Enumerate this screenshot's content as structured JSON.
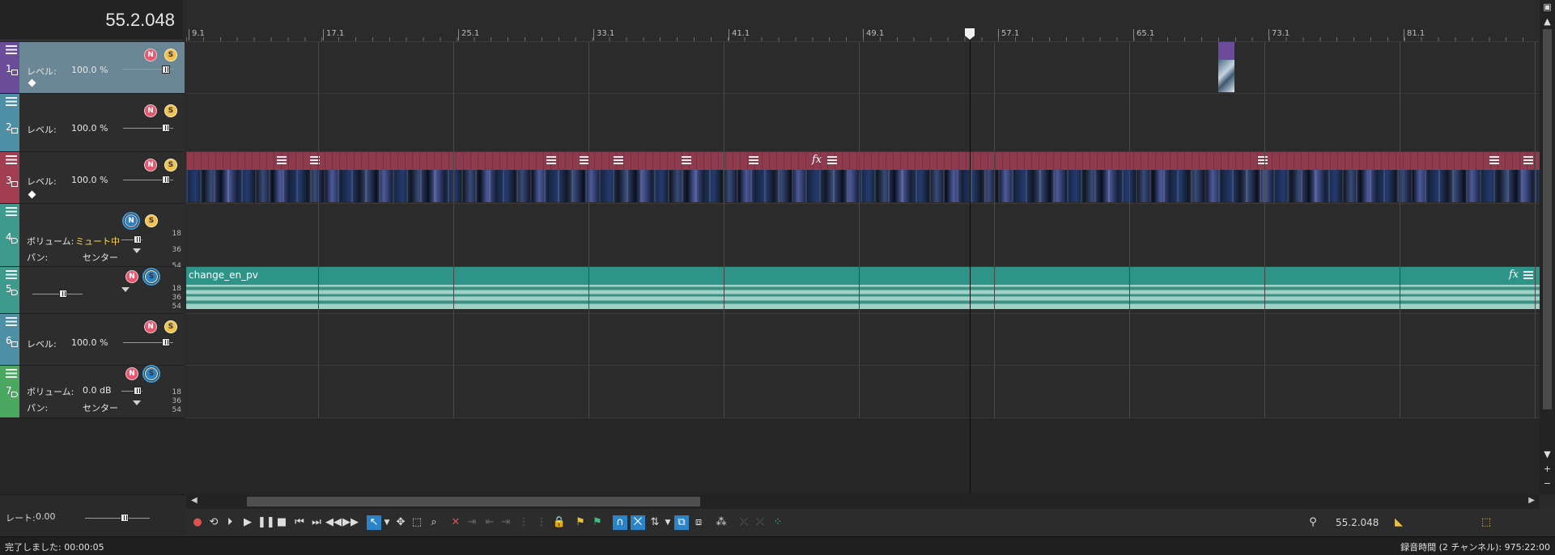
{
  "time_display": "55.2.048",
  "ruler": {
    "labels": [
      "9.1",
      "17.1",
      "25.1",
      "33.1",
      "41.1",
      "49.1",
      "57.1",
      "65.1",
      "73.1",
      "81.1"
    ]
  },
  "tracks": [
    {
      "number": "1",
      "color": "#6b4c9a",
      "type": "video",
      "param_label": "レベル:",
      "param_value": "100.0 %"
    },
    {
      "number": "2",
      "color": "#4d8fa5",
      "type": "video",
      "param_label": "レベル:",
      "param_value": "100.0 %"
    },
    {
      "number": "3",
      "color": "#a33d52",
      "type": "video",
      "param_label": "レベル:",
      "param_value": "100.0 %"
    },
    {
      "number": "4",
      "color": "#3f9a8e",
      "type": "audio",
      "param_label": "ボリューム:",
      "param_value": "ミュート中",
      "pan_label": "パン:",
      "pan_value": "センター",
      "db_scale": [
        "18",
        "36",
        "54"
      ]
    },
    {
      "number": "5",
      "color": "#3f9a8e",
      "type": "audio",
      "db_scale": [
        "18",
        "36",
        "54"
      ]
    },
    {
      "number": "6",
      "color": "#4d8fa5",
      "type": "video",
      "param_label": "レベル:",
      "param_value": "100.0 %"
    },
    {
      "number": "7",
      "color": "#4aa860",
      "type": "audio",
      "param_label": "ボリューム:",
      "param_value": "0.0 dB",
      "pan_label": "パン:",
      "pan_value": "センター",
      "db_scale": [
        "18",
        "36",
        "54"
      ]
    }
  ],
  "audio_event": {
    "name": "change_en_pv"
  },
  "rate": {
    "label": "レート:",
    "value": "0.00"
  },
  "transport": {
    "time": "55.2.048"
  },
  "status": {
    "left": "完了しました: 00:00:05",
    "right": "録音時間 (2 チャンネル): 975:22:00"
  },
  "colors": {
    "video_event": "#8e3b4d",
    "audio_event": "#2f9488",
    "selection": "#6b8796",
    "accent": "#2b84c8"
  },
  "icons": {
    "mute": "mute-icon",
    "solo": "solo-icon",
    "keyframe": "keyframe-icon"
  }
}
